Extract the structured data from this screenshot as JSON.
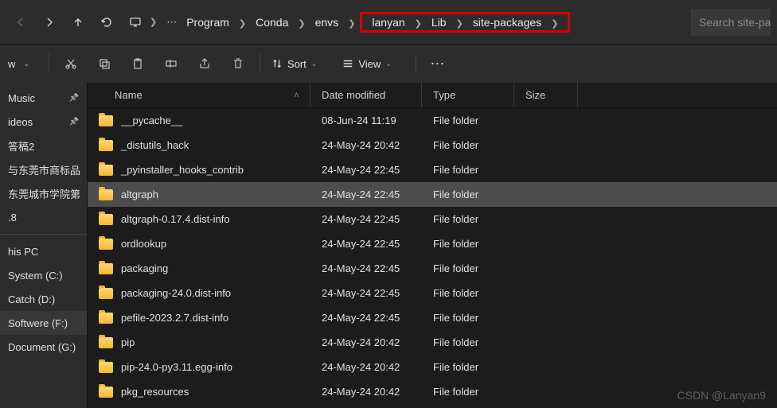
{
  "nav": {
    "backDisabled": true
  },
  "breadcrumb": {
    "pre": [
      {
        "label": "Program"
      },
      {
        "label": "Conda"
      },
      {
        "label": "envs"
      }
    ],
    "highlight": [
      {
        "label": "lanyan"
      },
      {
        "label": "Lib"
      },
      {
        "label": "site-packages"
      }
    ]
  },
  "search": {
    "placeholder": "Search site-pa"
  },
  "toolbar": {
    "new": "w",
    "sort": "Sort",
    "view": "View"
  },
  "sidebar": {
    "quick": [
      {
        "label": "Music",
        "pin": true
      },
      {
        "label": "ideos",
        "pin": true
      },
      {
        "label": "答稿2",
        "pin": false
      },
      {
        "label": "与东莞市商标品",
        "pin": false
      },
      {
        "label": "东莞城市学院第",
        "pin": false
      },
      {
        "label": ".8",
        "pin": false
      }
    ],
    "drives": [
      {
        "label": "his PC",
        "pin": false,
        "active": false
      },
      {
        "label": "System (C:)",
        "pin": false,
        "active": false
      },
      {
        "label": "Catch (D:)",
        "pin": false,
        "active": false
      },
      {
        "label": "Softwere (F:)",
        "pin": false,
        "active": true
      },
      {
        "label": "Document (G:)",
        "pin": false,
        "active": false
      }
    ]
  },
  "columns": {
    "name": "Name",
    "date": "Date modified",
    "type": "Type",
    "size": "Size"
  },
  "files": [
    {
      "name": "__pycache__",
      "date": "08-Jun-24 11:19",
      "type": "File folder",
      "selected": false
    },
    {
      "name": "_distutils_hack",
      "date": "24-May-24 20:42",
      "type": "File folder",
      "selected": false
    },
    {
      "name": "_pyinstaller_hooks_contrib",
      "date": "24-May-24 22:45",
      "type": "File folder",
      "selected": false
    },
    {
      "name": "altgraph",
      "date": "24-May-24 22:45",
      "type": "File folder",
      "selected": true
    },
    {
      "name": "altgraph-0.17.4.dist-info",
      "date": "24-May-24 22:45",
      "type": "File folder",
      "selected": false
    },
    {
      "name": "ordlookup",
      "date": "24-May-24 22:45",
      "type": "File folder",
      "selected": false
    },
    {
      "name": "packaging",
      "date": "24-May-24 22:45",
      "type": "File folder",
      "selected": false
    },
    {
      "name": "packaging-24.0.dist-info",
      "date": "24-May-24 22:45",
      "type": "File folder",
      "selected": false
    },
    {
      "name": "pefile-2023.2.7.dist-info",
      "date": "24-May-24 22:45",
      "type": "File folder",
      "selected": false
    },
    {
      "name": "pip",
      "date": "24-May-24 20:42",
      "type": "File folder",
      "selected": false
    },
    {
      "name": "pip-24.0-py3.11.egg-info",
      "date": "24-May-24 20:42",
      "type": "File folder",
      "selected": false
    },
    {
      "name": "pkg_resources",
      "date": "24-May-24 20:42",
      "type": "File folder",
      "selected": false
    }
  ],
  "watermark": "CSDN @Lanyan9"
}
